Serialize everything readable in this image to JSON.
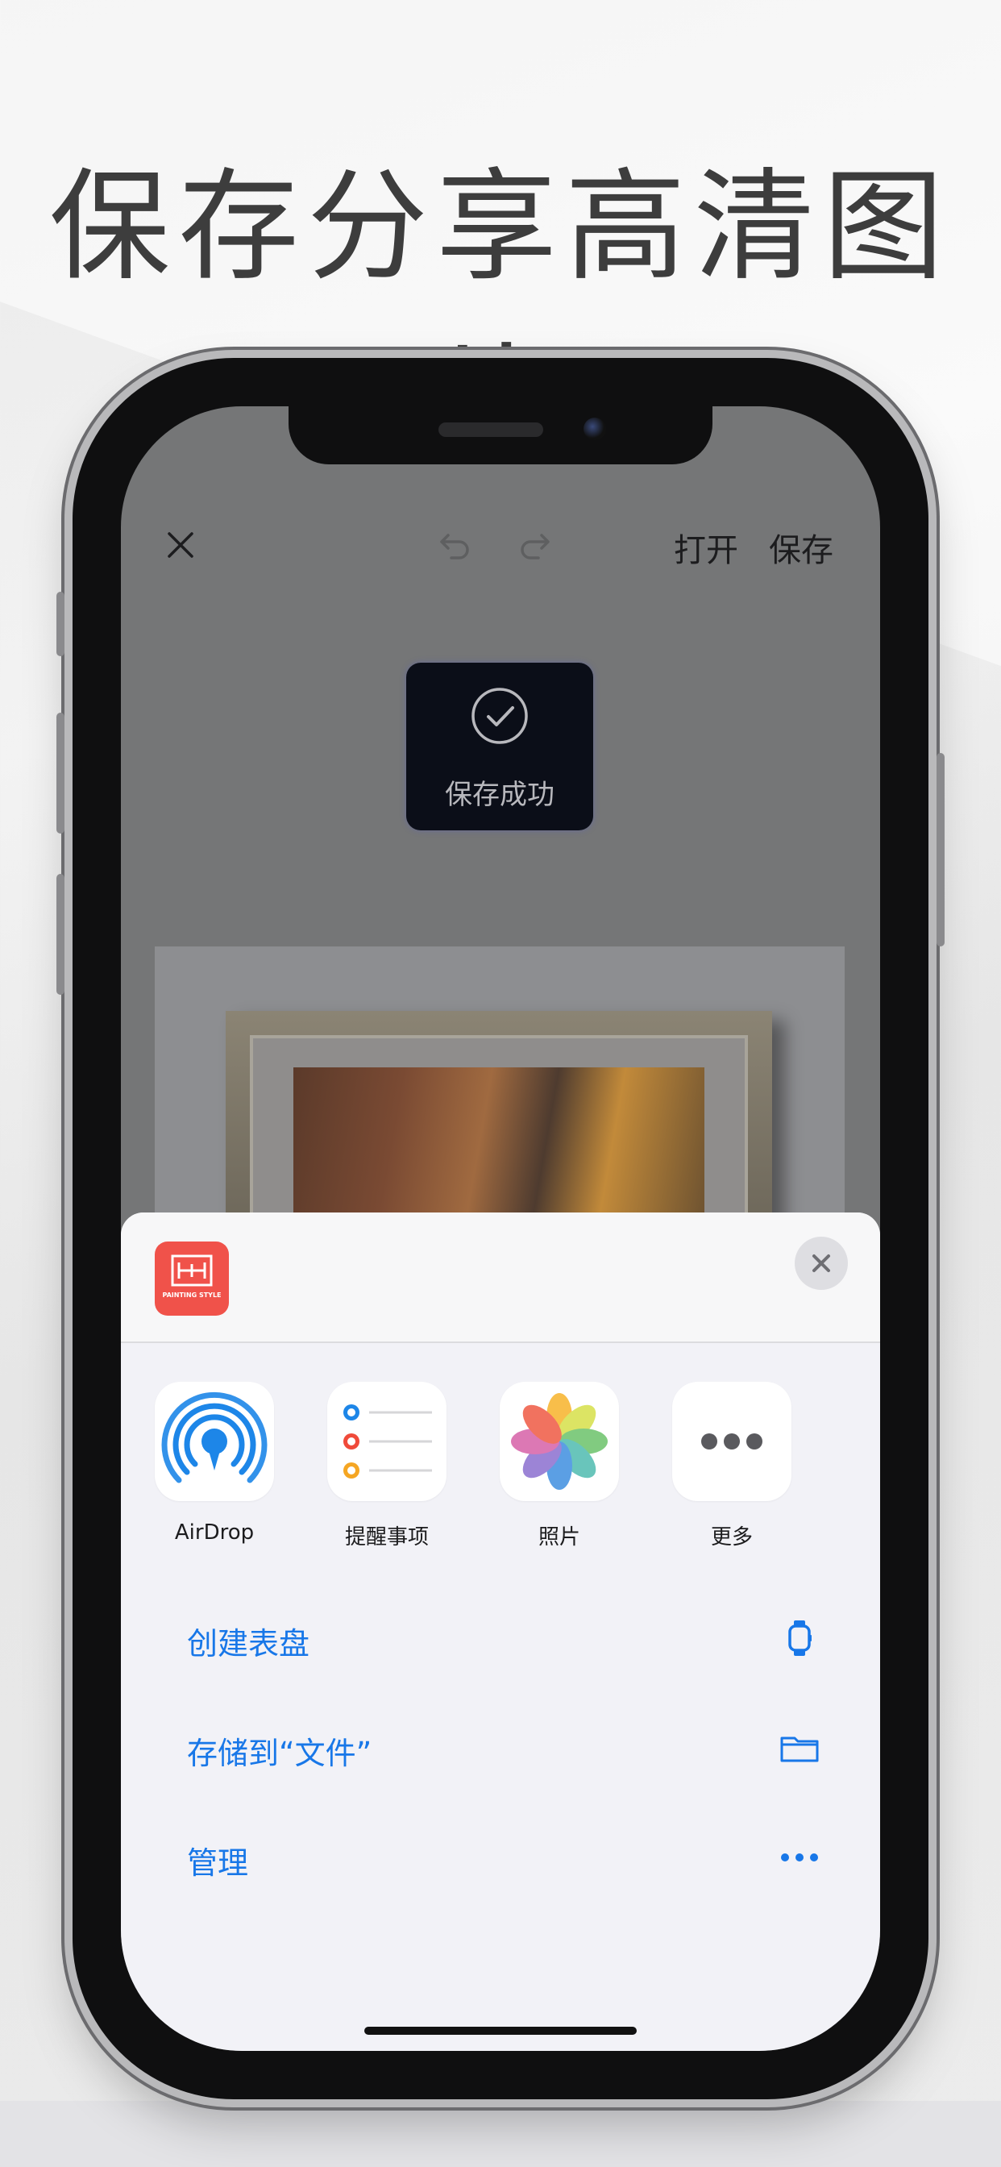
{
  "hero": {
    "title": "保存分享高清图片"
  },
  "topbar": {
    "open_label": "打开",
    "save_label": "保存"
  },
  "toast": {
    "text": "保存成功"
  },
  "app": {
    "logo_text": "PAINTING STYLE",
    "brand_color": "#f0524a"
  },
  "share_targets": [
    {
      "label": "AirDrop",
      "icon": "airdrop-icon"
    },
    {
      "label": "提醒事项",
      "icon": "reminders-icon"
    },
    {
      "label": "照片",
      "icon": "photos-icon"
    },
    {
      "label": "更多",
      "icon": "more-icon"
    }
  ],
  "actions": [
    {
      "label": "创建表盘",
      "icon": "watch-icon"
    },
    {
      "label": "存储到“文件”",
      "icon": "folder-icon"
    },
    {
      "label": "管理",
      "icon": "ellipsis-icon"
    }
  ],
  "colors": {
    "accent": "#1877e8",
    "sheet_bg": "#f2f2f7",
    "screen_dim": "#757677"
  }
}
